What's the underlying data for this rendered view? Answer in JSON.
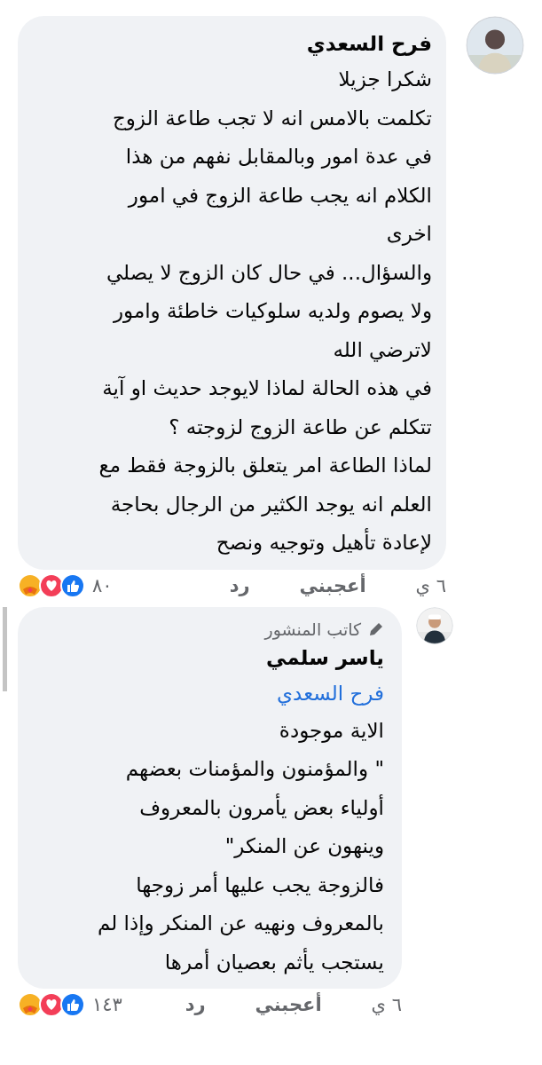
{
  "comments": [
    {
      "author": "فرح السعدي",
      "lines": [
        "شكرا جزيلا",
        "تكلمت بالامس انه لا تجب طاعة الزوج",
        "في عدة امور وبالمقابل نفهم من هذا",
        "الكلام انه يجب طاعة الزوج في امور",
        "اخرى",
        "والسؤال... في حال كان الزوج لا يصلي",
        "ولا يصوم ولديه سلوكيات خاطئة وامور",
        "لاترضي الله",
        "في هذه الحالة لماذا لايوجد حديث او آية",
        "تتكلم عن طاعة الزوج لزوجته ؟",
        "لماذا الطاعة امر يتعلق بالزوجة فقط مع",
        "العلم انه يوجد الكثير من الرجال بحاجة",
        "لإعادة تأهيل وتوجيه ونصح"
      ],
      "time": "٦ ي",
      "like": "أعجبني",
      "reply": "رد",
      "reaction_count": "٨٠",
      "replies": [
        {
          "badge": "كاتب المنشور",
          "author": "ياسر سلمي",
          "mention": "فرح السعدي",
          "lines": [
            "الاية موجودة",
            "\" والمؤمنون والمؤمنات بعضهم",
            "أولياء بعض يأمرون بالمعروف",
            "وينهون عن المنكر\"",
            "فالزوجة يجب عليها أمر زوجها",
            "بالمعروف ونهيه عن المنكر وإذا لم",
            "يستجب يأثم بعصيان أمرها"
          ],
          "time": "٦ ي",
          "like": "أعجبني",
          "reply": "رد",
          "reaction_count": "١٤٣"
        }
      ]
    }
  ]
}
